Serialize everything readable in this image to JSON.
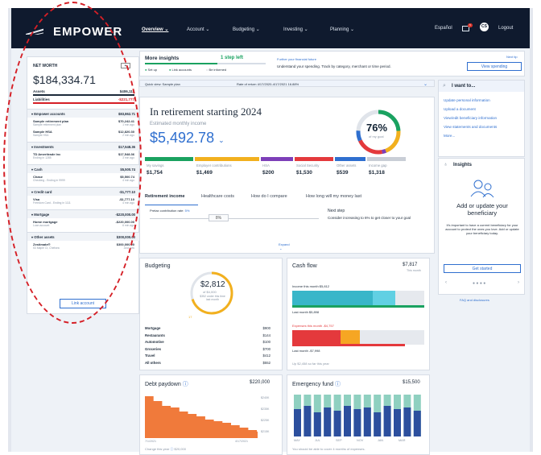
{
  "nav": {
    "logo": "EMPOWER",
    "items": [
      "Overview ⌄",
      "Account ⌄",
      "Budgeting ⌄",
      "Investing ⌄",
      "Planning ⌄"
    ],
    "language": "Español",
    "user_initials": "CS",
    "logout": "Logout"
  },
  "sidebar": {
    "title": "NET WORTH",
    "add": "+",
    "total": "$184,334.71",
    "assets_label": "Assets",
    "assets_value": "$406,111",
    "liab_label": "Liabilities",
    "liab_value": "-$221,777",
    "groups": [
      {
        "label": "▾ Empower accounts",
        "value": "$83,862.71",
        "items": [
          {
            "name": "Sample retirement plan",
            "sub": "Sample retirement plan",
            "value": "$70,242.41",
            "time": "1 min ago"
          },
          {
            "name": "Sample HSA",
            "sub": "Sample HSA",
            "value": "$12,820.30",
            "time": "2 min ago"
          }
        ]
      },
      {
        "label": "▾ Investments",
        "value": "$17,548.36",
        "items": [
          {
            "name": "TD Ameritrade Inc",
            "sub": "Ending in 1285",
            "value": "$17,548.36",
            "time": "3 min ago"
          }
        ]
      },
      {
        "label": "▾ Cash",
        "value": "$5,500.74",
        "items": [
          {
            "name": "Chase",
            "sub": "Checking - Ending in 9999",
            "value": "$5,500.74",
            "time": "4 min ago"
          }
        ]
      },
      {
        "label": "▾ Credit card",
        "value": "-$1,777.10",
        "items": [
          {
            "name": "Visa",
            "sub": "Freedom Card - Ending in 1111",
            "value": "-$1,777.10",
            "time": "4 min ago"
          }
        ]
      },
      {
        "label": "▾ Mortgage",
        "value": "-$220,000.00",
        "items": [
          {
            "name": "Home mortgage",
            "sub": "Loan account",
            "value": "-$220,000.00",
            "time": "6 min ago"
          }
        ]
      },
      {
        "label": "▾ Other assets",
        "value": "$300,000.00",
        "items": [
          {
            "name": "Zestimate®",
            "sub": "53 Maple Ct, Chelsea",
            "value": "$300,000.00",
            "time": "Just now"
          }
        ]
      }
    ],
    "link_account": "Link account"
  },
  "insights_bar": {
    "title": "More insights",
    "steps": "1 step left",
    "checks": [
      "Set up",
      "Link accounts",
      "Be informed"
    ],
    "further_title": "Further your financial future",
    "further_text": "Understand your spending. Track by category, merchant or time period.",
    "next_tip": "Next tip",
    "view_spending": "View spending"
  },
  "quickview": {
    "label": "Quick view: Sample plan",
    "rate": "Rate of return 4/17/2020-4/17/2021 16.88%"
  },
  "retirement": {
    "title": "In retirement starting 2024",
    "est_label": "Estimated monthly income",
    "amount": "$5,492.78",
    "percent": "76%",
    "percent_label": "of my goal",
    "goal_fraction": 0.76,
    "breakdown": [
      {
        "label": "My savings",
        "value": "$1,754",
        "color": "#1aa260"
      },
      {
        "label": "Employer contributions",
        "value": "$1,469",
        "color": "#f2b01e"
      },
      {
        "label": "HSA",
        "value": "$200",
        "color": "#7d3fb8"
      },
      {
        "label": "Social Security",
        "value": "$1,530",
        "color": "#e4393c"
      },
      {
        "label": "Other assets",
        "value": "$539",
        "color": "#2f6fcf"
      },
      {
        "label": "Income gap",
        "value": "$1,318",
        "color": "#c9ced6"
      }
    ],
    "tabs": [
      "Retirement income",
      "Healthcare costs",
      "How do I compare",
      "How long will my money last"
    ],
    "pretax_label": "Pretax contribution rate:",
    "pretax_value": "5%",
    "slider_value": "8%",
    "next_step": "Next step",
    "next_text": "Consider increasing to 6% to get closer to your goal",
    "expand": "Expand"
  },
  "want": {
    "title": "I want to...",
    "links": [
      "Update personal information",
      "Upload a document",
      "View/edit beneficiary information",
      "View statements and documents",
      "More..."
    ]
  },
  "insights": {
    "title": "Insights",
    "heading": "Add or update your beneficiary",
    "text": "It's important to have a current beneficiary for your account to protect the ones you love. Add or update your beneficiary today.",
    "button": "Get started",
    "faq": "FAQ and disclosures"
  },
  "budgeting": {
    "title": "Budgeting",
    "spent": "$2,812",
    "of": "of $4,000",
    "note": "$352 under this time last month",
    "progress": 0.7,
    "ring_label": "17",
    "rows": [
      {
        "label": "Mortgage",
        "value": "$900"
      },
      {
        "label": "Restaurants",
        "value": "$144"
      },
      {
        "label": "Automotive",
        "value": "$100"
      },
      {
        "label": "Groceries",
        "value": "$700"
      },
      {
        "label": "Travel",
        "value": "$412"
      },
      {
        "label": "All others",
        "value": "$552"
      }
    ]
  },
  "cashflow": {
    "title": "Cash flow",
    "value": "$7,817",
    "sub": "This month",
    "income_label": "Income this month $5,812",
    "income_last": "Last month $5,898",
    "expense_label": "Expenses this month -$4,757",
    "expense_last": "Last month -$7,998",
    "footer": "Up $2,458 so far this year"
  },
  "debt": {
    "title": "Debt paydown",
    "value": "$220,000",
    "axis": [
      "$240K",
      "$235K",
      "$225K",
      "$215K"
    ],
    "from": "7/1/2021",
    "to": "4/17/2021",
    "footer_label": "Change this year",
    "footer_value": "$20,000"
  },
  "emergency": {
    "title": "Emergency fund",
    "value": "$15,500",
    "months": [
      "MAY",
      "JUL",
      "SEP",
      "NOV",
      "JAN",
      "MAR"
    ],
    "footer": "You should be able to cover 4 months of expenses."
  }
}
